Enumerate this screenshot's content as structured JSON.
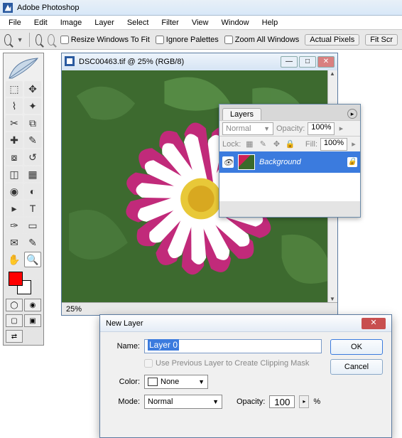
{
  "app": {
    "title": "Adobe Photoshop"
  },
  "menu": [
    "File",
    "Edit",
    "Image",
    "Layer",
    "Select",
    "Filter",
    "View",
    "Window",
    "Help"
  ],
  "options": {
    "resize": "Resize Windows To Fit",
    "ignore": "Ignore Palettes",
    "zoomall": "Zoom All Windows",
    "actual": "Actual Pixels",
    "fitscr": "Fit Scr"
  },
  "doc": {
    "title": "DSC00463.tif @ 25% (RGB/8)",
    "zoom": "25%"
  },
  "layers": {
    "tab": "Layers",
    "blend": "Normal",
    "opacity_label": "Opacity:",
    "opacity": "100%",
    "lock_label": "Lock:",
    "fill_label": "Fill:",
    "fill": "100%",
    "item_name": "Background"
  },
  "dialog": {
    "title": "New Layer",
    "name_label": "Name:",
    "name_value": "Layer 0",
    "clip": "Use Previous Layer to Create Clipping Mask",
    "color_label": "Color:",
    "color_value": "None",
    "mode_label": "Mode:",
    "mode_value": "Normal",
    "opacity_label": "Opacity:",
    "opacity_value": "100",
    "pct": "%",
    "ok": "OK",
    "cancel": "Cancel"
  }
}
